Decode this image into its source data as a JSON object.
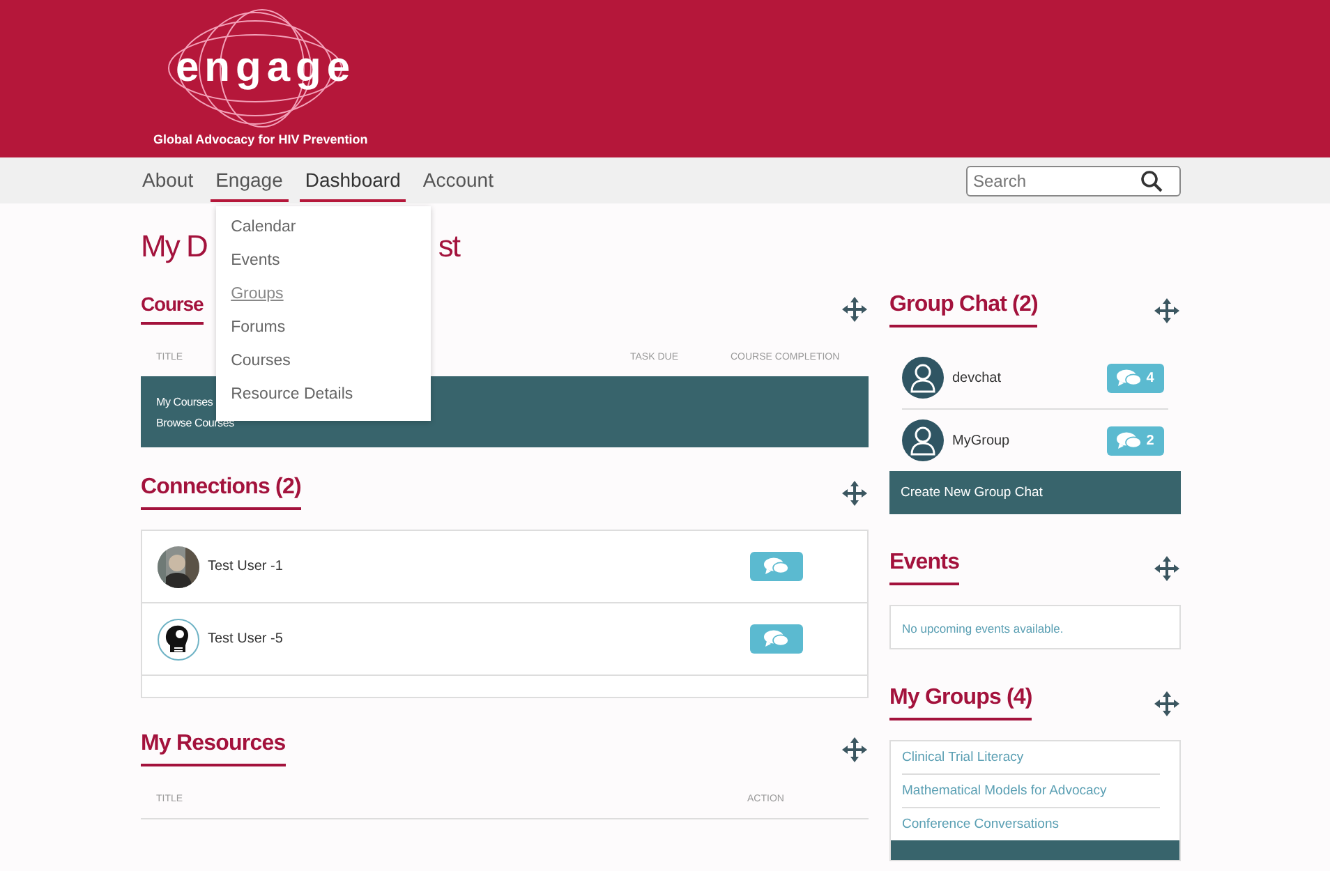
{
  "header": {
    "logo_text": "engage",
    "tagline": "Global Advocacy for HIV Prevention"
  },
  "nav": {
    "items": [
      {
        "label": "About",
        "selected": false,
        "expanded": false
      },
      {
        "label": "Engage",
        "selected": false,
        "expanded": true
      },
      {
        "label": "Dashboard",
        "selected": true,
        "expanded": false
      },
      {
        "label": "Account",
        "selected": false,
        "expanded": false
      }
    ],
    "search": {
      "placeholder": "Search"
    }
  },
  "dropdown": {
    "items": [
      {
        "label": "Calendar",
        "hovered": false
      },
      {
        "label": "Events",
        "hovered": false
      },
      {
        "label": "Groups",
        "hovered": true
      },
      {
        "label": "Forums",
        "hovered": false
      },
      {
        "label": "Courses",
        "hovered": false
      },
      {
        "label": "Resource Details",
        "hovered": false
      }
    ]
  },
  "page_title": {
    "visible_start": "My D",
    "visible_end": "st"
  },
  "courses": {
    "title": "Course",
    "columns": [
      "TITLE",
      "TASK DUE",
      "COURSE COMPLETION"
    ],
    "links": [
      "My Courses",
      "Browse Courses"
    ]
  },
  "connections": {
    "title": "Connections (2)",
    "items": [
      {
        "name": "Test User -1"
      },
      {
        "name": "Test User -5",
        "avatar": {
          "kind": "icon"
        }
      }
    ]
  },
  "resources": {
    "title": "My Resources",
    "columns": [
      "TITLE",
      "ACTION"
    ]
  },
  "group_chat": {
    "title": "Group Chat (2)",
    "items": [
      {
        "name": "devchat",
        "count": "4"
      },
      {
        "name": "MyGroup",
        "count": "2"
      }
    ],
    "create": "Create New Group Chat"
  },
  "events": {
    "title": "Events",
    "empty": "No upcoming events available."
  },
  "my_groups": {
    "title": "My Groups (4)",
    "items": [
      "Clinical Trial Literacy",
      "Mathematical Models for Advocacy",
      "Conference Conversations"
    ]
  }
}
